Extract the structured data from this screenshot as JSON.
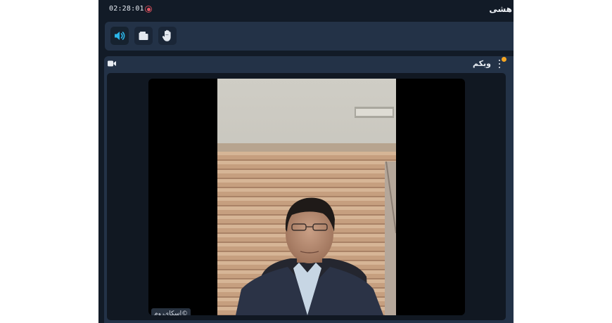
{
  "header": {
    "timer": "02:28:01",
    "room_title": "هشی",
    "recording_icon": "record-icon"
  },
  "toolbar": {
    "buttons": [
      {
        "name": "speaker-icon",
        "active": true
      },
      {
        "name": "folder-icon",
        "active": false
      },
      {
        "name": "raise-hand-icon",
        "active": false
      }
    ]
  },
  "webcam_panel": {
    "title": "وبکم",
    "header_icon": "video-camera-icon",
    "menu_icon": "more-vertical-icon",
    "notification_color": "#f5a623",
    "watermark": "©اسکای‌روم"
  },
  "colors": {
    "background": "#121b27",
    "panel": "#233247",
    "accent": "#2bb5e8",
    "record": "#e05663"
  }
}
